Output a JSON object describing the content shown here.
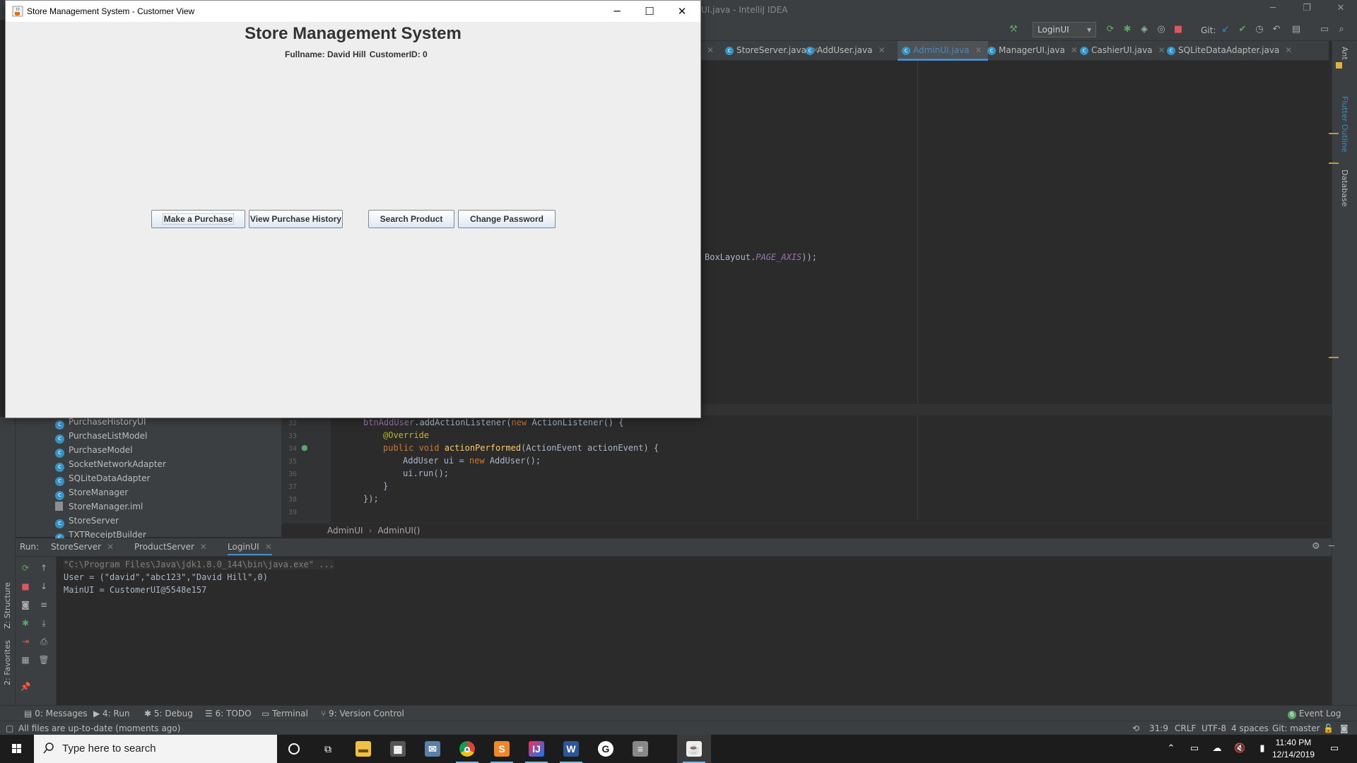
{
  "ide": {
    "title": "UI.java - IntelliJ IDEA",
    "run_config": "LoginUI",
    "git_label": "Git:",
    "tabs": [
      {
        "label": "StoreServer.java",
        "active": false
      },
      {
        "label": "AddUser.java",
        "active": false
      },
      {
        "label": "AdminUI.java",
        "active": true
      },
      {
        "label": "ManagerUI.java",
        "active": false
      },
      {
        "label": "CashierUI.java",
        "active": false
      },
      {
        "label": "SQLiteDataAdapter.java",
        "active": false
      }
    ],
    "code_fragment_plain": "BoxLayout.",
    "code_fragment_italic": "PAGE_AXIS",
    "code_fragment_end": "));",
    "right_strip_labels": [
      "Ant",
      "Flutter Outline",
      "Database"
    ],
    "left_strip_labels": [
      "Z: Structure",
      "2: Favorites"
    ],
    "project_tree": [
      {
        "label": "PurchaseHistoryUI",
        "kind": "class"
      },
      {
        "label": "PurchaseListModel",
        "kind": "class"
      },
      {
        "label": "PurchaseModel",
        "kind": "class"
      },
      {
        "label": "SocketNetworkAdapter",
        "kind": "class"
      },
      {
        "label": "SQLiteDataAdapter",
        "kind": "class"
      },
      {
        "label": "StoreManager",
        "kind": "class"
      },
      {
        "label": "StoreManager.iml",
        "kind": "file"
      },
      {
        "label": "StoreServer",
        "kind": "class"
      },
      {
        "label": "TXTReceiptBuilder",
        "kind": "class"
      }
    ],
    "line_numbers": [
      "32",
      "33",
      "34",
      "35",
      "36",
      "37",
      "38",
      "39"
    ],
    "code": {
      "l32_a": "btnAddUser",
      "l32_b": ".addActionListener(",
      "l32_c": "new ",
      "l32_d": "ActionListener() {",
      "l33": "@Override",
      "l34_a": "public void ",
      "l34_b": "actionPerformed",
      "l34_c": "(ActionEvent actionEvent) {",
      "l35_a": "AddUser ui = ",
      "l35_b": "new ",
      "l35_c": "AddUser();",
      "l36": "ui.run();",
      "l37": "}",
      "l38": "});"
    },
    "breadcrumbs": [
      "AdminUI",
      "AdminUI()"
    ],
    "run_panel": {
      "label": "Run:",
      "tabs": [
        "StoreServer",
        "ProductServer",
        "LoginUI"
      ],
      "console": [
        "\"C:\\Program Files\\Java\\jdk1.8.0_144\\bin\\java.exe\" ...",
        "User = (\"david\",\"abc123\",\"David Hill\",0)",
        "MainUI = CustomerUI@5548e157"
      ]
    },
    "bottom_tools": [
      "0: Messages",
      "4: Run",
      "5: Debug",
      "6: TODO",
      "Terminal",
      "9: Version Control"
    ],
    "event_log": "Event Log",
    "event_log_count": "6",
    "status": {
      "message": "All files are up-to-date (moments ago)",
      "position": "31:9",
      "line_sep": "CRLF",
      "encoding": "UTF-8",
      "indent": "4 spaces",
      "git": "Git: master"
    }
  },
  "app": {
    "window_title": "Store Management System - Customer View",
    "heading": "Store Management System",
    "fullname_label": "Fullname: David Hill",
    "customer_label": "CustomerID: 0",
    "buttons": [
      "Make a Purchase",
      "View Purchase History",
      "Search Product",
      "Change Password"
    ],
    "controls": {
      "minimize": "─",
      "maximize": "☐",
      "close": "✕"
    }
  },
  "taskbar": {
    "search_placeholder": "Type here to search",
    "time": "11:40 PM",
    "date": "12/14/2019",
    "apps": [
      "Cortana",
      "Task View",
      "File Explorer",
      "Calculator",
      "Mail",
      "Chrome",
      "Sublime Text",
      "IntelliJ IDEA",
      "Word",
      "Grammarly",
      "Database",
      "Java"
    ]
  },
  "colors": {
    "accent_blue": "#4a88c7",
    "button_gradient_end": "#dde8f3",
    "keyword": "#cc7832"
  }
}
